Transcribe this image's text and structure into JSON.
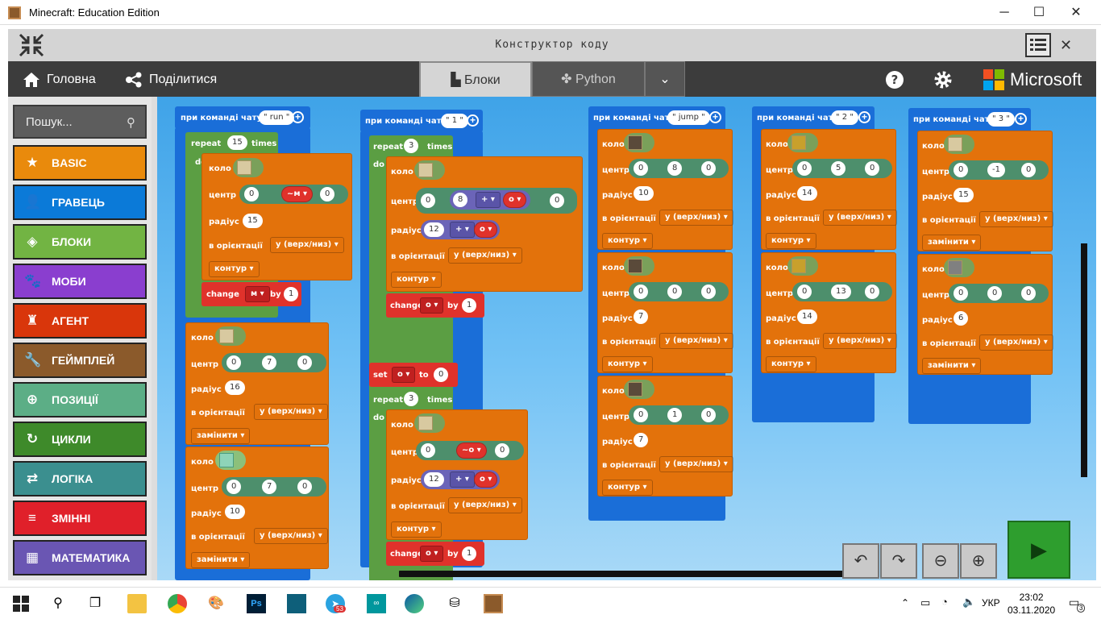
{
  "window": {
    "title": "Minecraft: Education Edition",
    "minimize": "─",
    "maximize": "☐",
    "close": "✕"
  },
  "code_builder": {
    "title": "Конструктор коду",
    "close": "✕"
  },
  "nav": {
    "home": "Головна",
    "share": "Поділитися",
    "tab_blocks": "Блоки",
    "tab_python": "Python",
    "brand": "Microsoft"
  },
  "sidebar": {
    "search_placeholder": "Пошук...",
    "categories": [
      {
        "label": "BASIC",
        "color": "#e98a0c",
        "icon": "star-icon",
        "glyph": "★"
      },
      {
        "label": "ГРАВЕЦЬ",
        "color": "#0b7ad8",
        "icon": "player-icon",
        "glyph": "👤"
      },
      {
        "label": "БЛОКИ",
        "color": "#72b443",
        "icon": "cube-icon",
        "glyph": "◈"
      },
      {
        "label": "МОБИ",
        "color": "#8a3ecf",
        "icon": "paw-icon",
        "glyph": "🐾"
      },
      {
        "label": "АГЕНТ",
        "color": "#d9360b",
        "icon": "agent-icon",
        "glyph": "♜"
      },
      {
        "label": "ГЕЙМПЛЕЙ",
        "color": "#8b5a2b",
        "icon": "wrench-icon",
        "glyph": "🔧"
      },
      {
        "label": "ПОЗИЦІЇ",
        "color": "#5cae86",
        "icon": "position-icon",
        "glyph": "⊕"
      },
      {
        "label": "ЦИКЛИ",
        "color": "#3e8a2a",
        "icon": "loop-icon",
        "glyph": "↻"
      },
      {
        "label": "ЛОГІКА",
        "color": "#3b8f8f",
        "icon": "logic-icon",
        "glyph": "⇄"
      },
      {
        "label": "ЗМІННІ",
        "color": "#e0202a",
        "icon": "variables-icon",
        "glyph": "≡"
      },
      {
        "label": "МАТЕМАТИКА",
        "color": "#6a56b3",
        "icon": "calculator-icon",
        "glyph": "▦"
      }
    ]
  },
  "blocks": {
    "on_chat": "при команді чату",
    "repeat": "repeat",
    "times": "times",
    "do": "do",
    "sphere": "коло",
    "center": "центр",
    "radius": "радіус",
    "orientation": "в орієнтації",
    "orient_val": "у (верх/низ)",
    "outline": "контур",
    "replace": "замінити",
    "change": "change",
    "by": "by",
    "set": "set",
    "to": "to",
    "plus_op": "+",
    "var_m": "м",
    "var_o": "о",
    "cmd_run": "run",
    "cmd_1": "1",
    "cmd_jump": "jump",
    "cmd_2": "2",
    "cmd_3": "3",
    "n0": "0",
    "n1": "1",
    "n3": "3",
    "n5": "5",
    "n6": "6",
    "n7": "7",
    "n8": "8",
    "n10": "10",
    "n12": "12",
    "n13": "13",
    "n14": "14",
    "n15": "15",
    "n16": "16",
    "nm1": "-1"
  },
  "taskbar": {
    "time": "23:02",
    "date": "03.11.2020",
    "lang": "УКР",
    "badge": "53",
    "notif": "3"
  }
}
